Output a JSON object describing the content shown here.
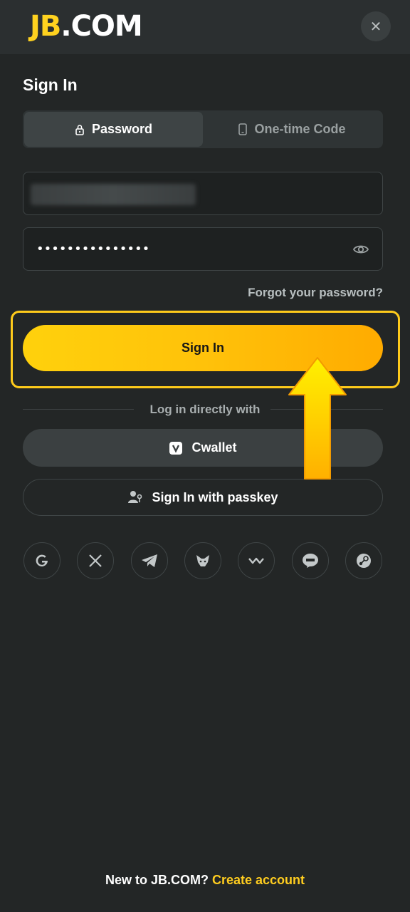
{
  "header": {
    "logo_jb": "JB",
    "logo_com": ".COM",
    "close_symbol": "✕"
  },
  "title": "Sign In",
  "tabs": [
    {
      "label": "Password",
      "icon": "lock-icon",
      "active": true
    },
    {
      "label": "One-time Code",
      "icon": "phone-icon",
      "active": false
    }
  ],
  "form": {
    "email_value": "",
    "password_value": "•••••••••••••••",
    "forgot_label": "Forgot your password?",
    "submit_label": "Sign In"
  },
  "divider_label": "Log in directly with",
  "cwallet_label": "Cwallet",
  "passkey_label": "Sign In with passkey",
  "social": [
    {
      "name": "google-icon"
    },
    {
      "name": "x-icon"
    },
    {
      "name": "telegram-icon"
    },
    {
      "name": "metamask-icon"
    },
    {
      "name": "walletconnect-icon"
    },
    {
      "name": "line-icon"
    },
    {
      "name": "steam-icon"
    }
  ],
  "footer": {
    "question": "New to JB.COM?",
    "link": "Create account"
  },
  "colors": {
    "accent": "#ffd21f",
    "background": "#232626",
    "highlight": "#ffcb1b"
  }
}
